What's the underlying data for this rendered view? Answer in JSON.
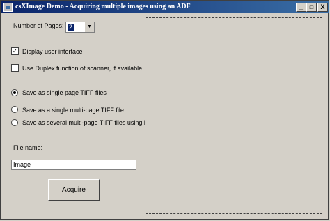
{
  "window": {
    "title": "csXImage Demo - Acquiring multiple images using an ADF"
  },
  "captions": {
    "minimize": "_",
    "maximize": "□",
    "close": "X"
  },
  "pages": {
    "label": "Number of Pages:",
    "value": "2",
    "arrow": "▼"
  },
  "options": {
    "display_ui": {
      "label": "Display user interface",
      "checked": true,
      "mark": "✓"
    },
    "duplex": {
      "label": "Use Duplex function of scanner, if available",
      "checked": false
    }
  },
  "save_modes": [
    {
      "label": "Save as single page TIFF files",
      "selected": true
    },
    {
      "label": "Save as a single multi-page TIFF file",
      "selected": false
    },
    {
      "label": "Save as several multi-page TIFF files using blank s",
      "selected": false
    }
  ],
  "file": {
    "label": "File name:",
    "value": "Image"
  },
  "acquire": {
    "label": "Acquire"
  },
  "colors": {
    "titlebar_start": "#0a246a",
    "titlebar_end": "#3a6ea5",
    "face": "#d4d0c8"
  }
}
